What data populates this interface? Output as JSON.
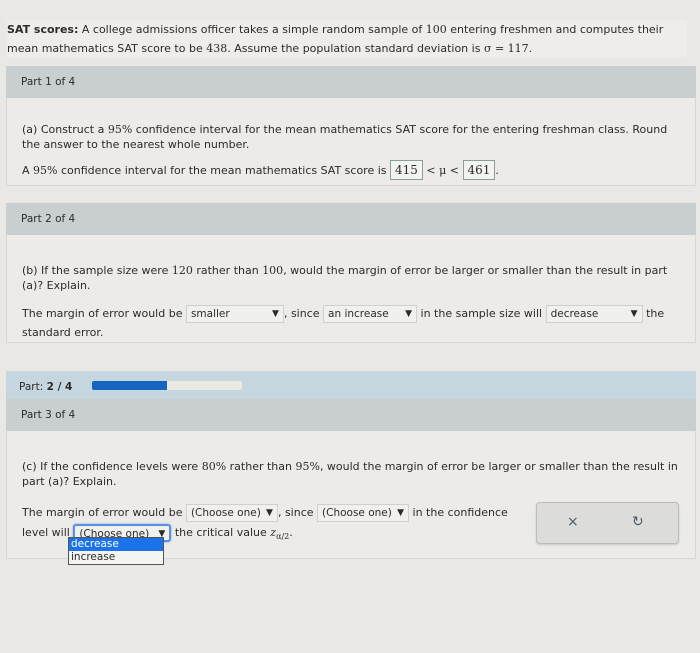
{
  "intro": {
    "label": "SAT scores:",
    "text_1": " A college admissions officer takes a simple random sample of ",
    "n": "100",
    "text_2": " entering freshmen and computes their mean mathematics SAT score to be ",
    "mean": "438",
    "text_3": ". Assume the population standard deviation is ",
    "sigma_expr": "σ = 117",
    "text_4": "."
  },
  "part1": {
    "header": "Part 1 of 4",
    "question_1": "(a) Construct a ",
    "question_pct": "95%",
    "question_2": " confidence interval for the mean mathematics SAT score for the entering freshman class. Round the answer to the nearest whole number.",
    "answer_1": "A ",
    "answer_pct": "95%",
    "answer_2": " confidence interval for the mean mathematics SAT score is ",
    "lower": "415",
    "mu_expr": " < μ < ",
    "upper": "461",
    "end": "."
  },
  "part2": {
    "header": "Part 2 of 4",
    "question_1": "(b) If the sample size were ",
    "n_new": "120",
    "question_2": " rather than ",
    "n_old": "100",
    "question_3": ", would the margin of error be larger or smaller than the result in part (a)? Explain.",
    "ans_1": "The margin of error would be ",
    "sel_1": "smaller",
    "ans_2": ", since ",
    "sel_2": "an increase",
    "ans_3": " in the sample size will ",
    "sel_3": "decrease",
    "ans_4": " the",
    "ans_5": "standard error."
  },
  "progress": {
    "label": "Part: ",
    "value_text": "2 / 4",
    "fraction": 0.5
  },
  "part3": {
    "header": "Part 3 of 4",
    "question_1": "(c) If the confidence levels were ",
    "pct_new": "80%",
    "question_2": " rather than ",
    "pct_old": "95%",
    "question_3": ", would the margin of error be larger or smaller than the result in part (a)? Explain.",
    "ans_1": "The margin of error would be ",
    "sel_1": "(Choose one)",
    "ans_2": ", since ",
    "sel_2": "(Choose one)",
    "ans_3": " in the confidence",
    "ans_4": "level will ",
    "sel_3": "(Choose one)",
    "ans_5": " the critical value ",
    "z": "z",
    "z_sub": "α/2",
    "ans_6": ".",
    "dropdown_options": [
      "decrease",
      "increase"
    ],
    "dropdown_highlighted": "decrease"
  },
  "actions": {
    "clear_icon": "×",
    "undo_icon": "↻"
  },
  "colors": {
    "progress_fill": "#1565c0",
    "highlight": "#1a73e8"
  }
}
